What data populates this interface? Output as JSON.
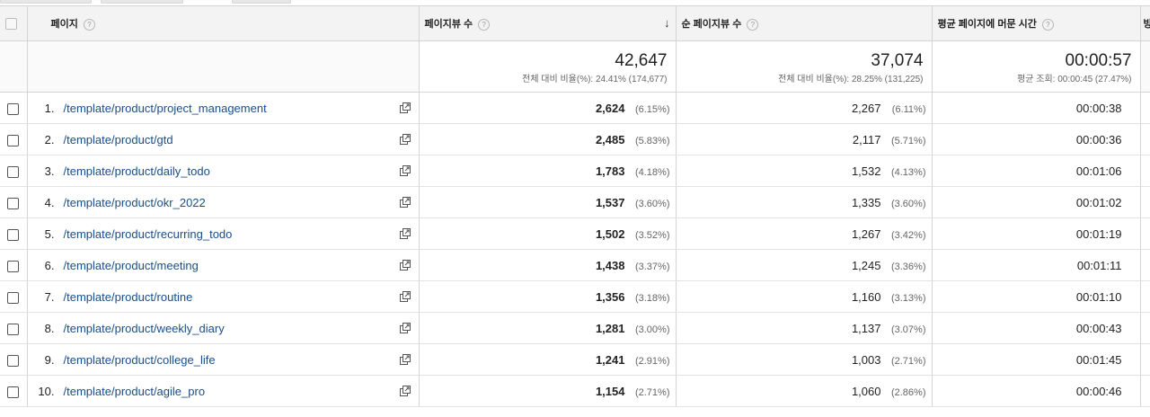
{
  "headers": {
    "page": "페이지",
    "pageviews": "페이지뷰 수",
    "unique_pageviews": "순 페이지뷰 수",
    "avg_time": "평균 페이지에 머문 시간",
    "next_partial": "방",
    "help_glyph": "?",
    "sort_glyph": "↓"
  },
  "summary": {
    "pageviews": {
      "value": "42,647",
      "sub": "전체 대비 비율(%): 24.41% (174,677)"
    },
    "unique_pageviews": {
      "value": "37,074",
      "sub": "전체 대비 비율(%): 28.25% (131,225)"
    },
    "avg_time": {
      "value": "00:00:57",
      "sub": "평균 조회: 00:00:45 (27.47%)"
    }
  },
  "rows": [
    {
      "idx": "1.",
      "page": "/template/product/project_management",
      "pv": "2,624",
      "pv_pct": "(6.15%)",
      "uv": "2,267",
      "uv_pct": "(6.11%)",
      "time": "00:00:38"
    },
    {
      "idx": "2.",
      "page": "/template/product/gtd",
      "pv": "2,485",
      "pv_pct": "(5.83%)",
      "uv": "2,117",
      "uv_pct": "(5.71%)",
      "time": "00:00:36"
    },
    {
      "idx": "3.",
      "page": "/template/product/daily_todo",
      "pv": "1,783",
      "pv_pct": "(4.18%)",
      "uv": "1,532",
      "uv_pct": "(4.13%)",
      "time": "00:01:06"
    },
    {
      "idx": "4.",
      "page": "/template/product/okr_2022",
      "pv": "1,537",
      "pv_pct": "(3.60%)",
      "uv": "1,335",
      "uv_pct": "(3.60%)",
      "time": "00:01:02"
    },
    {
      "idx": "5.",
      "page": "/template/product/recurring_todo",
      "pv": "1,502",
      "pv_pct": "(3.52%)",
      "uv": "1,267",
      "uv_pct": "(3.42%)",
      "time": "00:01:19"
    },
    {
      "idx": "6.",
      "page": "/template/product/meeting",
      "pv": "1,438",
      "pv_pct": "(3.37%)",
      "uv": "1,245",
      "uv_pct": "(3.36%)",
      "time": "00:01:11"
    },
    {
      "idx": "7.",
      "page": "/template/product/routine",
      "pv": "1,356",
      "pv_pct": "(3.18%)",
      "uv": "1,160",
      "uv_pct": "(3.13%)",
      "time": "00:01:10"
    },
    {
      "idx": "8.",
      "page": "/template/product/weekly_diary",
      "pv": "1,281",
      "pv_pct": "(3.00%)",
      "uv": "1,137",
      "uv_pct": "(3.07%)",
      "time": "00:00:43"
    },
    {
      "idx": "9.",
      "page": "/template/product/college_life",
      "pv": "1,241",
      "pv_pct": "(2.91%)",
      "uv": "1,003",
      "uv_pct": "(2.71%)",
      "time": "00:01:45"
    },
    {
      "idx": "10.",
      "page": "/template/product/agile_pro",
      "pv": "1,154",
      "pv_pct": "(2.71%)",
      "uv": "1,060",
      "uv_pct": "(2.86%)",
      "time": "00:00:46"
    }
  ],
  "icons": {
    "row_link": "open-in-new-window-icon",
    "help": "help-circle-icon",
    "sort": "sort-descending-arrow-icon"
  },
  "colors": {
    "link": "#1a4e8a",
    "header_bg": "#f3f3f3",
    "border": "#d4d4d4"
  }
}
